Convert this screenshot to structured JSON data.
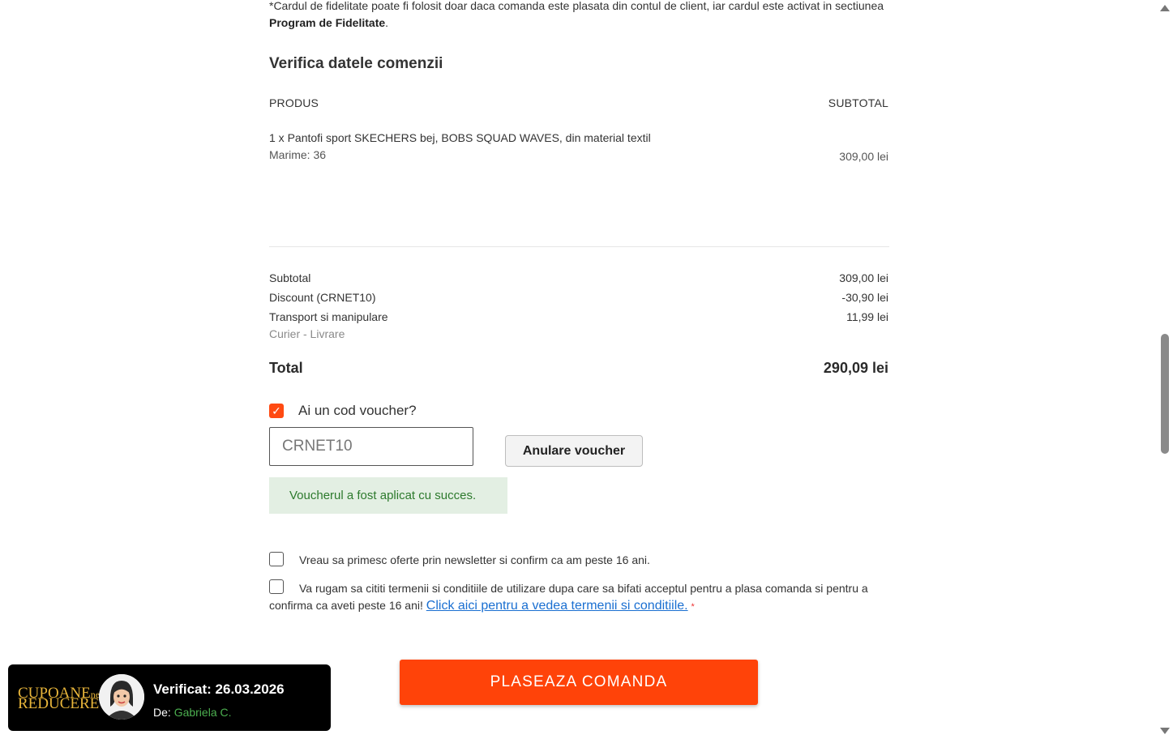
{
  "note": {
    "text_prefix": "*Cardul de fidelitate poate fi folosit doar daca comanda este plasata din contul de client, iar cardul este activat in sectiunea ",
    "text_bold": "Program de Fidelitate",
    "text_suffix": "."
  },
  "order_review": {
    "title": "Verifica datele comenzii",
    "col_product": "PRODUS",
    "col_subtotal": "SUBTOTAL",
    "items": [
      {
        "name": "1 x Pantofi sport SKECHERS bej, BOBS SQUAD WAVES, din material textil",
        "size": "Marime: 36",
        "price": "309,00 lei"
      }
    ]
  },
  "totals": {
    "subtotal_label": "Subtotal",
    "subtotal_value": "309,00 lei",
    "discount_label": "Discount (CRNET10)",
    "discount_value": "-30,90 lei",
    "shipping_label": "Transport si manipulare",
    "shipping_value": "11,99 lei",
    "shipping_method": "Curier - Livrare",
    "total_label": "Total",
    "total_value": "290,09 lei"
  },
  "voucher": {
    "question": "Ai un cod voucher?",
    "checked": true,
    "code_value": "CRNET10",
    "cancel_label": "Anulare voucher",
    "success_message": "Voucherul a fost aplicat cu succes."
  },
  "consents": {
    "newsletter": "Vreau sa primesc oferte prin newsletter si confirm ca am peste 16 ani.",
    "terms_text": "Va rugam sa cititi termenii si conditiile de utilizare dupa care sa bifati acceptul pentru a plasa comanda si pentru a confirma ca aveti peste 16 ani! ",
    "terms_link": "Click aici pentru a vedea termenii si conditiile.",
    "required_marker": "*"
  },
  "place_order_label": "PLASEAZA COMANDA",
  "badge": {
    "brand_line1": "CUPOANE",
    "brand_suffix": "net",
    "brand_line2": "REDUCERE",
    "verified": "Verificat: 26.03.2026",
    "author_prefix": "De: ",
    "author_name": "Gabriela C."
  },
  "colors": {
    "accent": "#ff4309",
    "success_bg": "#e3efe3",
    "success_text": "#2d7a2d",
    "link": "#1a6fd1"
  }
}
